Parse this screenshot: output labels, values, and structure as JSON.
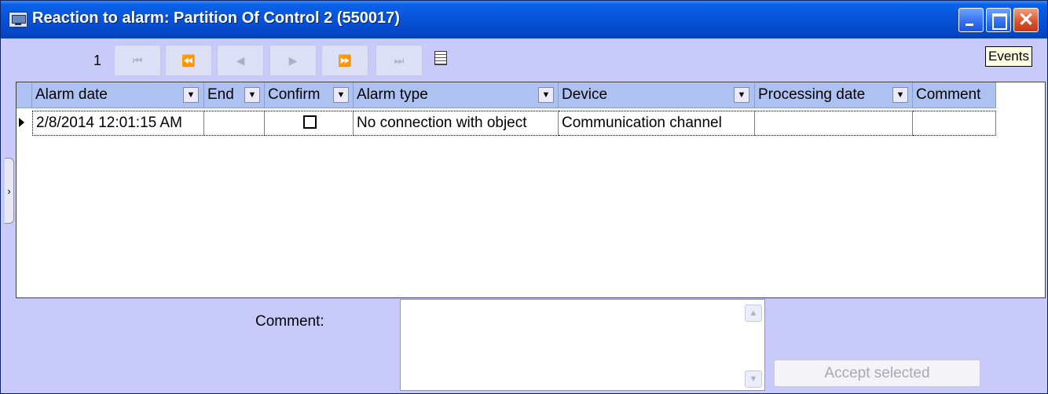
{
  "window": {
    "title": "Reaction to alarm: Partition Of Control 2 (550017)",
    "controls": {
      "close": "✕"
    }
  },
  "toolbar": {
    "page_number": "1",
    "nav": [
      {
        "name": "first-page-button",
        "icon": "⏮"
      },
      {
        "name": "previous-page-button",
        "icon": "⏪"
      },
      {
        "name": "previous-record-button",
        "icon": "◀"
      },
      {
        "name": "next-record-button",
        "icon": "▶"
      },
      {
        "name": "next-page-button",
        "icon": "⏩"
      },
      {
        "name": "last-page-button",
        "icon": "⏭"
      }
    ],
    "grid_icon": "grid-icon",
    "tooltip": "Events"
  },
  "grid": {
    "columns": [
      {
        "label": "Alarm date",
        "filter": true
      },
      {
        "label": "End",
        "filter": true
      },
      {
        "label": "Confirm",
        "filter": true
      },
      {
        "label": "Alarm type",
        "filter": true
      },
      {
        "label": "Device",
        "filter": true
      },
      {
        "label": "Processing date",
        "filter": true
      },
      {
        "label": "Comment",
        "filter": false
      }
    ],
    "rows": [
      {
        "alarm_date": "2/8/2014 12:01:15 AM",
        "end": "",
        "confirm": false,
        "alarm_type": "No connection with object",
        "device": "Communication channel",
        "processing_date": "",
        "comment": ""
      }
    ],
    "filter_glyph": "▼",
    "row_pointer_icon": "row-pointer-icon"
  },
  "side_tab": {
    "glyph": "›"
  },
  "comment": {
    "label": "Comment:",
    "value": "",
    "scroll_up": "▲",
    "scroll_down": "▼"
  },
  "accept_button": {
    "label": "Accept selected",
    "enabled": false
  },
  "colors": {
    "titlebar": "#0852d8",
    "window_background": "#c8cbfa",
    "header_background": "#aec2f2"
  }
}
